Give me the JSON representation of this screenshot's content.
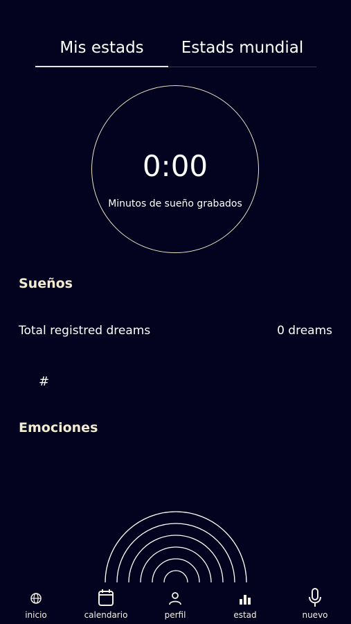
{
  "tabs": {
    "mine": "Mis estads",
    "world": "Estads mundial"
  },
  "timer": {
    "value": "0:00",
    "label": "Minutos de sueño grabados"
  },
  "dreams": {
    "title": "Sueños",
    "total_label": "Total registred dreams",
    "total_value": "0 dreams",
    "hash": "#"
  },
  "emotions": {
    "title": "Emociones"
  },
  "nav": [
    {
      "label": "inicio",
      "icon": "globe-icon"
    },
    {
      "label": "calendario",
      "icon": "calendar-icon"
    },
    {
      "label": "perfil",
      "icon": "person-icon"
    },
    {
      "label": "estad",
      "icon": "bar-chart-icon"
    },
    {
      "label": "nuevo",
      "icon": "microphone-icon"
    }
  ],
  "colors": {
    "background": "#03031f",
    "accent": "#ece3c4",
    "text": "#ffffff"
  }
}
